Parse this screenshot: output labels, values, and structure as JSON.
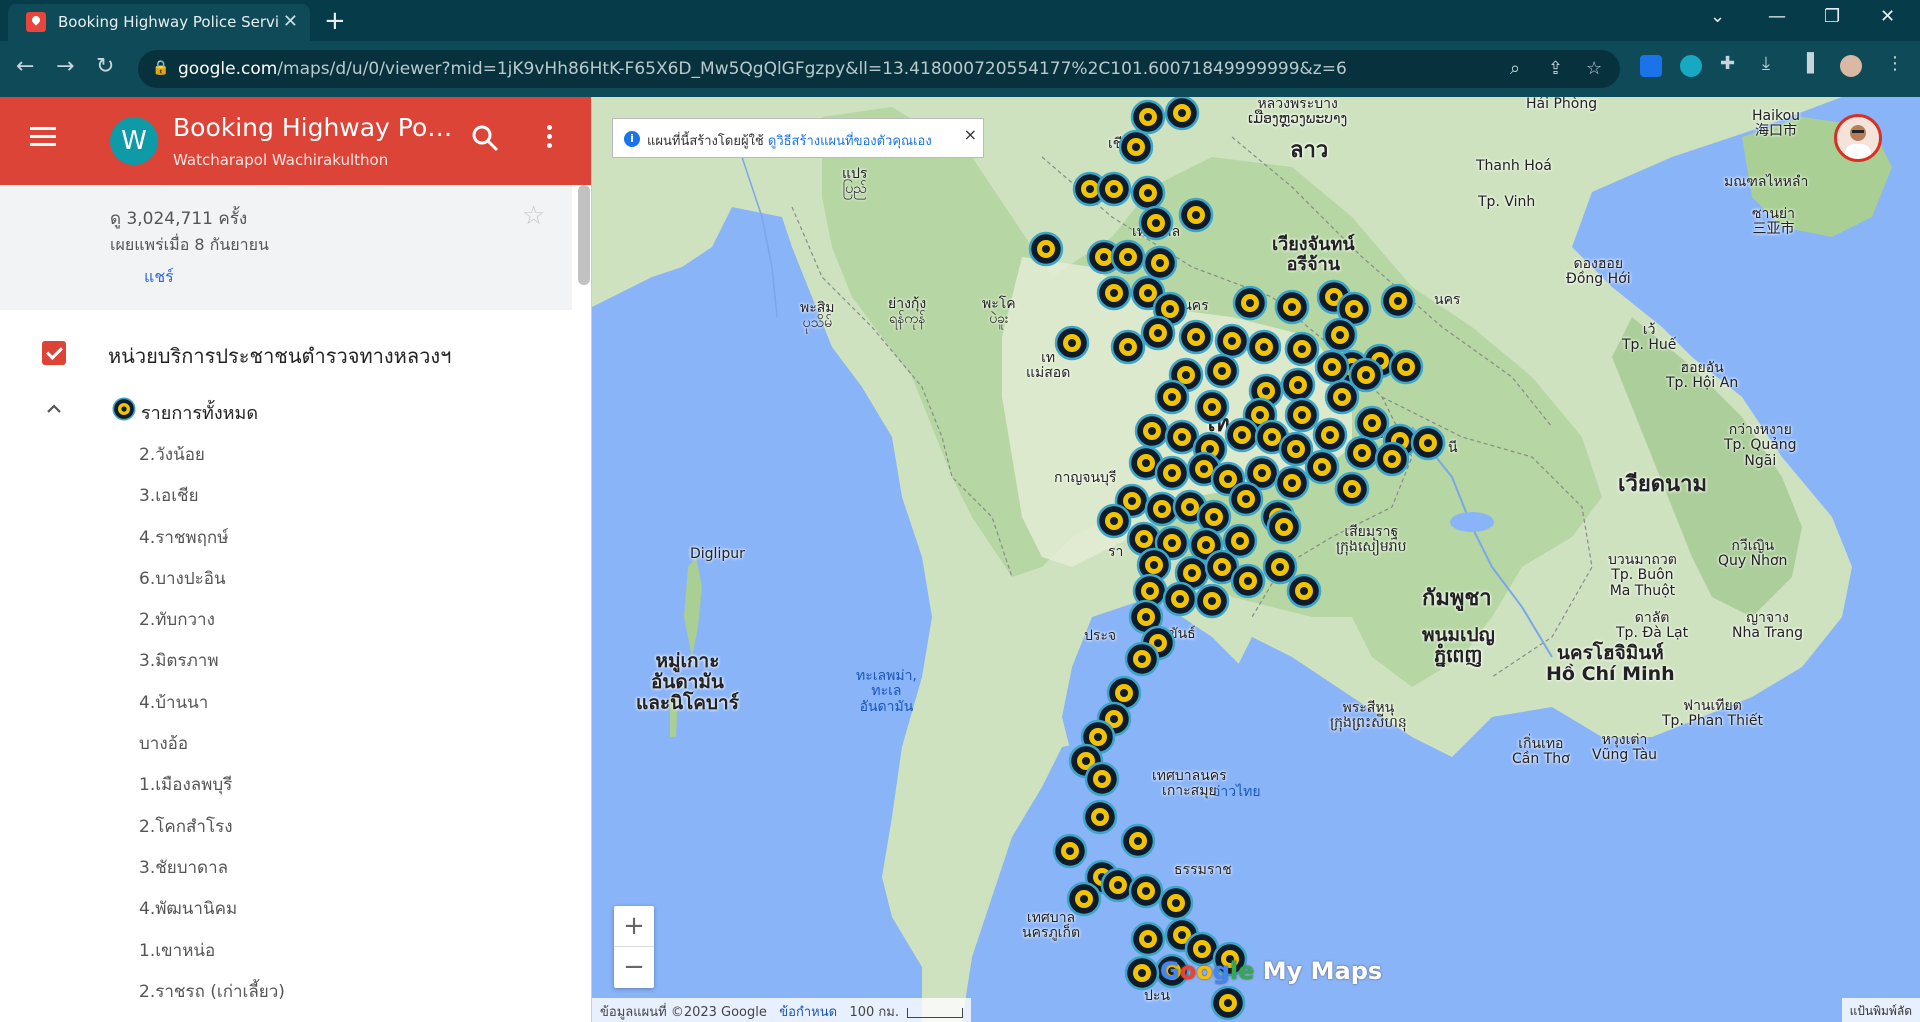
{
  "browser": {
    "tab_title": "Booking Highway Police Service /",
    "tab_close": "✕",
    "new_tab": "+",
    "url_host": "google.com",
    "url_path": "/maps/d/u/0/viewer?mid=1jK9vHh86HtK-F65X6D_Mw5QgQlGFgzpy&ll=13.418000720554177%2C101.60071849999999&z=6"
  },
  "panel": {
    "avatar_letter": "W",
    "title": "Booking Highway Police Service",
    "owner": "Watcharapol Wachirakulthon",
    "views": "ดู 3,024,711 ครั้ง",
    "published": "เผยแพร่เมื่อ 8 กันยายน",
    "share": "แชร์",
    "layer_name": "หน่วยบริการประชาชนตำรวจทางหลวงฯ",
    "group_label": "รายการทั้งหมด",
    "items": [
      "2.วังน้อย",
      "3.เอเชีย",
      "4.ราชพฤกษ์",
      "6.บางปะอิน",
      "2.ทับกวาง",
      "3.มิตรภาพ",
      "4.บ้านนา",
      "บางอ้อ",
      "1.เมืองลพบุรี",
      "2.โคกสำโรง",
      "3.ชัยบาดาล",
      "4.พัฒนานิคม",
      "1.เขาหน่อ",
      "2.ราชรถ (เก่าเลี้ยว)"
    ]
  },
  "map": {
    "notice_text": "แผนที่นี้สร้างโดยผู้ใช้",
    "notice_link": "ดูวิธีสร้างแผนที่ของตัวคุณเอง",
    "notice_close": "×",
    "zoom_in": "+",
    "zoom_out": "−",
    "watermark": {
      "g1": "G",
      "g2": "o",
      "g3": "o",
      "g4": "g",
      "g5": "le",
      "rest": " My Maps"
    },
    "attribution": "ข้อมูลแผนที่ ©2023 Google",
    "terms": "ข้อกำหนด",
    "scale": "100 กม.",
    "map_view": "แป้นพิมพ์ลัด",
    "labels": {
      "haiphong": "Hải Phòng",
      "haikou": "Haikou\n海口市",
      "hainan": "มณฑลไหหลำ",
      "sanya": "ซานย่า\n三亚市",
      "laos": "ลาว",
      "luang": "หลวงพระบาง\nເມືອງຫຼວງພະບາງ",
      "thanhhoa": "Thanh Hoá",
      "vinh": "Tp. Vinh",
      "vientiane": "เวียงจันทน์\nอรีจ้าน",
      "donghoi": "ดองฮอย\nĐồng Hới",
      "hue": "เว้\nTp. Huế",
      "hoian": "ฮอยอัน\nTp. Hội An",
      "quangngai": "กว่างหงาย\nTp. Quảng\nNgãi",
      "vietnam": "เวียดนาม",
      "quynhon": "กวีเญิน\nQuy Nhơn",
      "buonmathuot": "บวนมาถวต\nTp. Buôn\nMa Thuột",
      "nhatrang": "ญาจาง\nNha Trang",
      "dalat": "ดาลัต\nTp. Đà Lạt",
      "cambodia": "กัมพูชา",
      "siemreap": "เสียมราฐ\nក្រុងសៀមរាប",
      "phnompenh": "พนมเปญ\nភ្នំពេញ",
      "hcm": "นครโฮจิมินห์\nHồ Chí Minh",
      "phanthiet": "ฟานเทียต\nTp. Phan Thiết",
      "vungtau": "หวุงเต่า\nVũng Tàu",
      "cantho": "เกิ่นเทอ\nCần Thơ",
      "sihanouk": "พระสีหนุ\nក្រុងព្រះសីហនុ",
      "gulf": "อ่าวไทย",
      "andaman_sea": "ทะเลพม่า,\nทะเล\nอันดามัน",
      "andaman_isl": "หมู่เกาะ\nอันดามัน\nและนิโคบาร์",
      "diglipur": "Diglipur",
      "pathein": "พะสิม\nပုသိမ်",
      "yangon": "ย่างกุ้ง\nရန်ကုန်",
      "pegu": "พะโค\nပဲခူး",
      "prome": "แปร\nပြည်",
      "maesot": "เท\nแม่สอด",
      "kanchanaburi": "กาญจนบุรี",
      "ra": "รา",
      "prachuap": "ประจ",
      "khan": "ขันธ์",
      "samui": "เทศบาลนคร\nเกาะสมุย",
      "nakhon": "ธรรมราช",
      "phuket": "เทศบาล\nนครภูเก็ต",
      "pathom": "ปะน",
      "thai": "ไท",
      "sri": "ศรี",
      "ni": "นี",
      "nakhon2": "นคร",
      "tesaban": "ศบาลนคร",
      "tesaban2": "เทศบาล",
      "chiang": "เชียงใ"
    }
  }
}
